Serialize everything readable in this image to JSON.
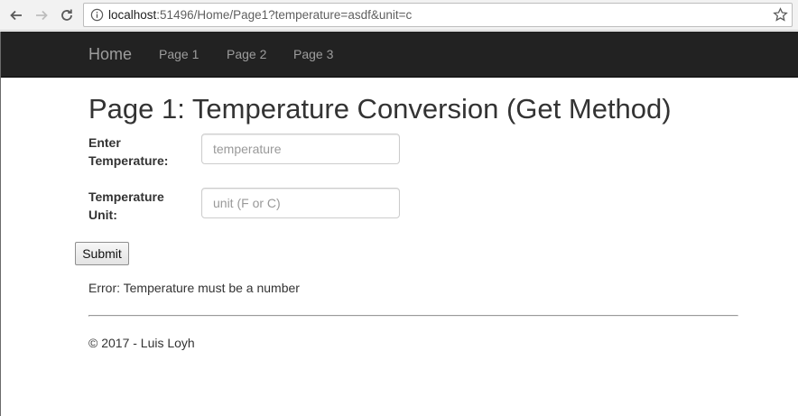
{
  "browser": {
    "url_host": "localhost",
    "url_rest": ":51496/Home/Page1?temperature=asdf&unit=c"
  },
  "navbar": {
    "brand": "Home",
    "links": [
      "Page 1",
      "Page 2",
      "Page 3"
    ]
  },
  "main": {
    "title": "Page 1: Temperature Conversion (Get Method)",
    "temperature_label": "Enter Temperature:",
    "temperature_placeholder": "temperature",
    "temperature_value": "",
    "unit_label": "Temperature Unit:",
    "unit_placeholder": "unit (F or C)",
    "unit_value": "",
    "submit_label": "Submit",
    "error": "Error: Temperature must be a number"
  },
  "footer": {
    "text": "© 2017 - Luis Loyh"
  },
  "colors": {
    "navbar_bg": "#222222",
    "navbar_text": "#9d9d9d",
    "body_text": "#333333"
  },
  "icons": [
    "back-arrow-icon",
    "forward-arrow-icon",
    "reload-icon",
    "info-icon",
    "bookmark-star-icon"
  ]
}
